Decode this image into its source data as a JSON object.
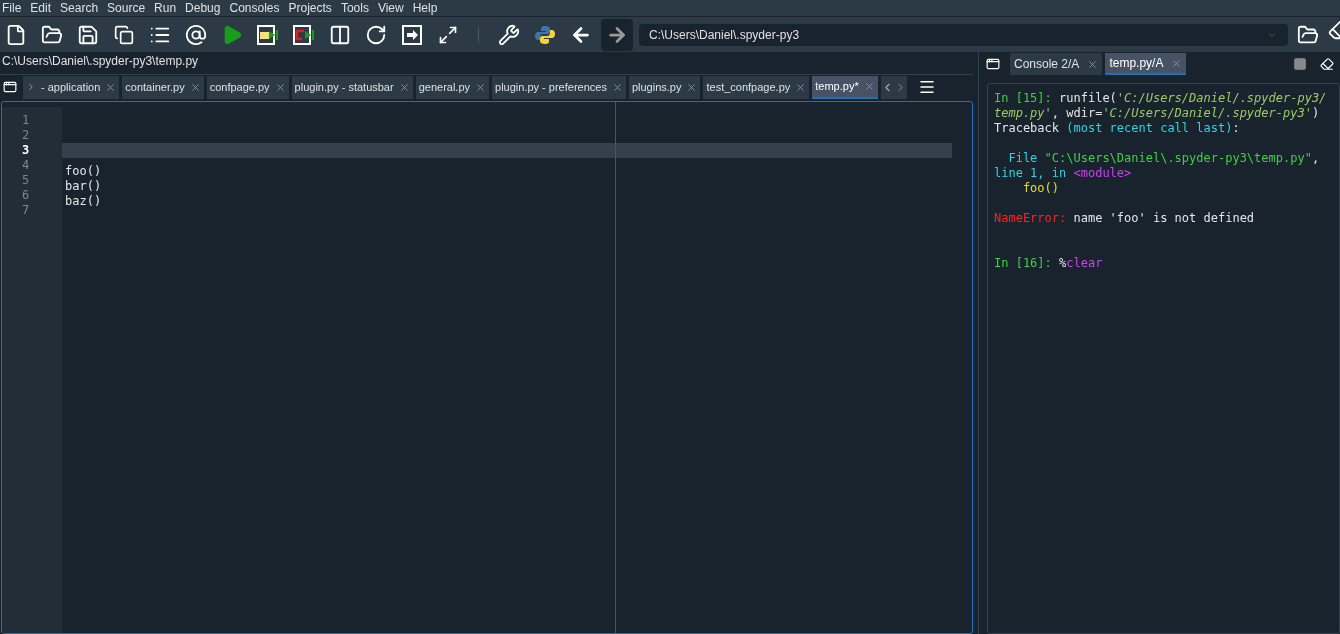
{
  "menu_bar": [
    "File",
    "Edit",
    "Search",
    "Source",
    "Run",
    "Debug",
    "Consoles",
    "Projects",
    "Tools",
    "View",
    "Help"
  ],
  "working_directory": {
    "value": "C:\\Users\\Daniel\\.spyder-py3"
  },
  "file_path": "C:\\Users\\Daniel\\.spyder-py3\\temp.py",
  "editor_tabs": [
    {
      "label": "- application",
      "selected": false
    },
    {
      "label": "container.py",
      "selected": false
    },
    {
      "label": "confpage.py",
      "selected": false
    },
    {
      "label": "plugin.py - statusbar",
      "selected": false
    },
    {
      "label": "general.py",
      "selected": false
    },
    {
      "label": "plugin.py - preferences",
      "selected": false
    },
    {
      "label": "plugins.py",
      "selected": false
    },
    {
      "label": "test_confpage.py",
      "selected": false
    },
    {
      "label": "temp.py*",
      "selected": true
    }
  ],
  "editor_lines": [
    {
      "number": "1",
      "current": false
    },
    {
      "number": "2",
      "current": false
    },
    {
      "number": "3",
      "current": true
    },
    {
      "number": "4",
      "code": "foo()",
      "current": false
    },
    {
      "number": "5",
      "code": "bar()",
      "current": false
    },
    {
      "number": "6",
      "code": "baz()",
      "current": false
    },
    {
      "number": "7",
      "current": false
    }
  ],
  "console_tabs": [
    {
      "label": "Console 2/A",
      "selected": false
    },
    {
      "label": "temp.py/A",
      "selected": true
    }
  ],
  "console_lines": [
    {
      "kind": "text",
      "segments": [
        {
          "kind": "prompt",
          "text": "In [15]: "
        },
        {
          "kind": "plain",
          "text": "runfile("
        },
        {
          "kind": "string",
          "text": "'C:/Users/Daniel/.spyder-py3/"
        }
      ]
    },
    {
      "kind": "text",
      "segments": [
        {
          "kind": "string",
          "text": "temp.py'"
        },
        {
          "kind": "plain",
          "text": ", wdir="
        },
        {
          "kind": "string",
          "text": "'C:/Users/Daniel/.spyder-py3'"
        },
        {
          "kind": "plain",
          "text": ")"
        }
      ]
    },
    {
      "kind": "text",
      "segments": [
        {
          "kind": "plain",
          "text": "Traceback "
        },
        {
          "kind": "cyan",
          "text": "(most recent call last)"
        },
        {
          "kind": "plain",
          "text": ":"
        }
      ]
    },
    {
      "kind": "blank"
    },
    {
      "kind": "text",
      "segments": [
        {
          "kind": "cyan",
          "text": "  File "
        },
        {
          "kind": "prompt",
          "text": "\"C:\\Users\\Daniel\\.spyder-py3\\temp.py\""
        },
        {
          "kind": "plain",
          "text": ","
        }
      ]
    },
    {
      "kind": "text",
      "segments": [
        {
          "kind": "cyan",
          "text": "line 1, in "
        },
        {
          "kind": "magenta",
          "text": "<module>"
        }
      ]
    },
    {
      "kind": "text",
      "segments": [
        {
          "kind": "yellow",
          "text": "    foo()"
        }
      ]
    },
    {
      "kind": "blank"
    },
    {
      "kind": "text",
      "segments": [
        {
          "kind": "error",
          "text": "NameError:"
        },
        {
          "kind": "plain",
          "text": " name 'foo' is not defined"
        }
      ]
    },
    {
      "kind": "blank"
    },
    {
      "kind": "blank"
    },
    {
      "kind": "text",
      "segments": [
        {
          "kind": "prompt",
          "text": "In [16]: "
        },
        {
          "kind": "plain",
          "text": "%"
        },
        {
          "kind": "magenta",
          "text": "clear"
        }
      ]
    }
  ]
}
